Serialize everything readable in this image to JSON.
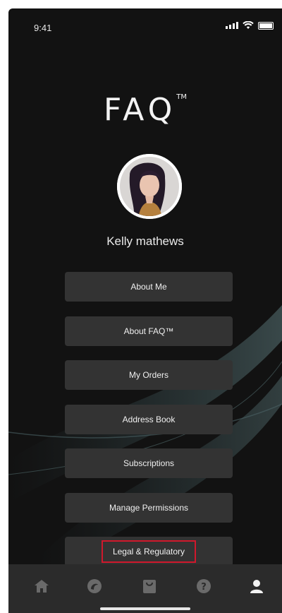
{
  "status_bar": {
    "time": "9:41"
  },
  "brand": {
    "logo": "FAQ",
    "trademark": "TM"
  },
  "profile": {
    "name": "Kelly mathews"
  },
  "menu": {
    "items": [
      {
        "label": "About Me"
      },
      {
        "label": "About FAQ™"
      },
      {
        "label": "My Orders"
      },
      {
        "label": "Address Book"
      },
      {
        "label": "Subscriptions"
      },
      {
        "label": "Manage Permissions"
      },
      {
        "label": "Legal & Regulatory",
        "highlighted": true
      }
    ]
  },
  "tab_bar": {
    "items": [
      {
        "icon": "home-icon"
      },
      {
        "icon": "discover-icon"
      },
      {
        "icon": "shop-bag-icon"
      },
      {
        "icon": "help-icon"
      },
      {
        "icon": "profile-icon",
        "active": true
      }
    ]
  },
  "colors": {
    "background": "#121212",
    "button": "#333333",
    "tabbar": "#2b2b2b",
    "highlight": "#d0182c"
  }
}
